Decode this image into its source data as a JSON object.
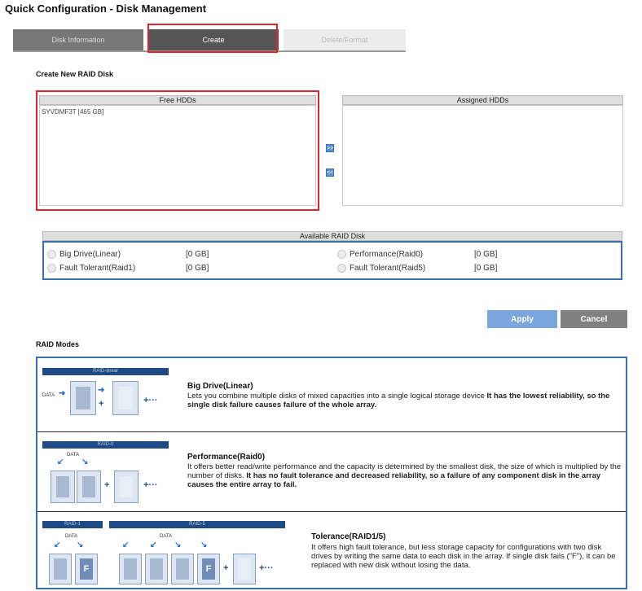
{
  "page_title": "Quick Configuration - Disk Management",
  "tabs": {
    "disk_information": "Disk Information",
    "create": "Create",
    "delete_format": "Delete/Format"
  },
  "create_section": {
    "title": "Create New RAID Disk",
    "free_hdds_header": "Free HDDs",
    "assigned_hdds_header": "Assigned HDDs",
    "free_hdds": [
      "SYVDMF3T [465 GB]"
    ],
    "move_right": ">>",
    "move_left": "<<"
  },
  "available_raid": {
    "header": "Available RAID Disk",
    "options": [
      {
        "label": "Big Drive(Linear)",
        "capacity": "[0 GB]"
      },
      {
        "label": "Performance(Raid0)",
        "capacity": "[0 GB]"
      },
      {
        "label": "Fault Tolerant(Raid1)",
        "capacity": "[0 GB]"
      },
      {
        "label": "Fault Tolerant(Raid5)",
        "capacity": "[0 GB]"
      }
    ]
  },
  "buttons": {
    "apply": "Apply",
    "cancel": "Cancel"
  },
  "raid_modes": {
    "title": "RAID Modes",
    "linear": {
      "bar": "RAID-linear",
      "data_label": "DATA",
      "title": "Big Drive(Linear)",
      "desc_normal": "Lets you combine multiple disks of mixed capacities into a single logical storage device ",
      "desc_bold": "It has the lowest reliability, so the single disk failure causes failure of the whole array."
    },
    "raid0": {
      "bar": "RAID-0",
      "data_label": "DATA",
      "title": "Performance(Raid0)",
      "desc_normal": "It offers better read/write performance and the capacity is determined by the smallest disk, the size of which is multiplied by the number of disks. ",
      "desc_bold": "It has no fault tolerance and decreased reliability, so a failure of any component disk in the array causes the entire array to fail."
    },
    "tolerance": {
      "bar1": "RAID-1",
      "bar5": "RAID-5",
      "data_label": "DATA",
      "fault_letter": "F",
      "title": "Tolerance(RAID1/5)",
      "desc": "It offers high fault tolerance, but less storage capacity for configurations with two disk drives by writing the same data to each disk in the array. If single disk fails (\"F\"), it can be replaced with new disk without losing the data."
    },
    "plus": "+",
    "ellipsis_plus": "+···"
  },
  "colors": {
    "highlight": "#e0242c",
    "accent_blue": "#3a6fb1",
    "raid_bar": "#1f4a86"
  }
}
